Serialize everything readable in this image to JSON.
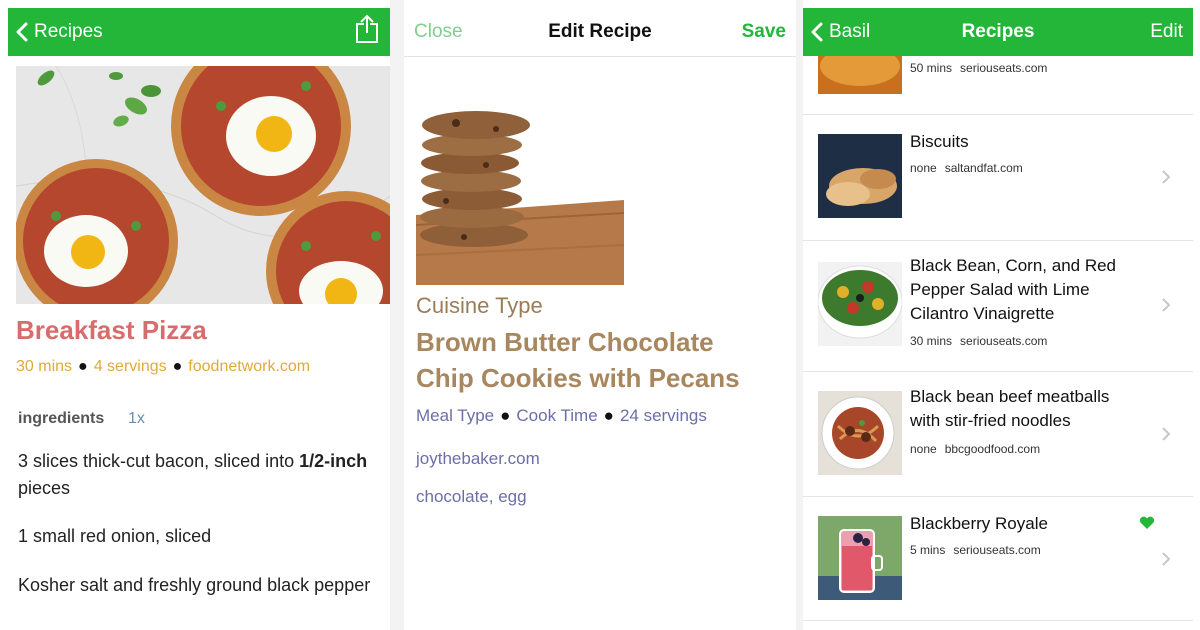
{
  "panel1": {
    "nav": {
      "back_label": "Recipes"
    },
    "recipe": {
      "title": "Breakfast Pizza",
      "time": "30 mins",
      "servings": "4 servings",
      "source": "foodnetwork.com"
    },
    "ingredients": {
      "heading": "ingredients",
      "multiplier": "1x",
      "items": [
        {
          "pre": "3 slices thick-cut bacon, sliced into ",
          "bold": "1/2-inch",
          "post": " pieces"
        },
        {
          "pre": "1 small red onion, sliced",
          "bold": "",
          "post": ""
        },
        {
          "pre": "Kosher salt and freshly ground black pepper",
          "bold": "",
          "post": ""
        }
      ]
    }
  },
  "panel2": {
    "close_label": "Close",
    "title": "Edit Recipe",
    "save_label": "Save",
    "cuisine": "Cuisine Type",
    "recipe_title": "Brown Butter Chocolate Chip Cookies with Pecans",
    "meal_type": "Meal Type",
    "cook_time": "Cook Time",
    "servings": "24 servings",
    "source": "joythebaker.com",
    "tags": "chocolate, egg"
  },
  "panel3": {
    "nav": {
      "back_label": "Basil",
      "title": "Recipes",
      "edit_label": "Edit"
    },
    "rows": [
      {
        "name": "",
        "time": "50 mins",
        "source": "seriouseats.com",
        "favorite": false,
        "thumb": "orange-dish"
      },
      {
        "name": "Biscuits",
        "time": "none",
        "source": "saltandfat.com",
        "favorite": false,
        "thumb": "biscuits"
      },
      {
        "name": "Black Bean, Corn, and Red Pepper Salad with Lime Cilantro Vinaigrette",
        "time": "30 mins",
        "source": "seriouseats.com",
        "favorite": false,
        "thumb": "salad"
      },
      {
        "name": "Black bean beef meatballs with stir-fried noodles",
        "time": "none",
        "source": "bbcgoodfood.com",
        "favorite": false,
        "thumb": "noodles"
      },
      {
        "name": "Blackberry Royale",
        "time": "5 mins",
        "source": "seriouseats.com",
        "favorite": true,
        "thumb": "drink"
      }
    ]
  },
  "colors": {
    "nav_green": "#23b639",
    "title_pink": "#d86c6c",
    "meta_gold": "#e0a93a",
    "cookie_brown": "#a8875e",
    "link_purple": "#6b6fa6",
    "heart_green": "#23b639"
  }
}
